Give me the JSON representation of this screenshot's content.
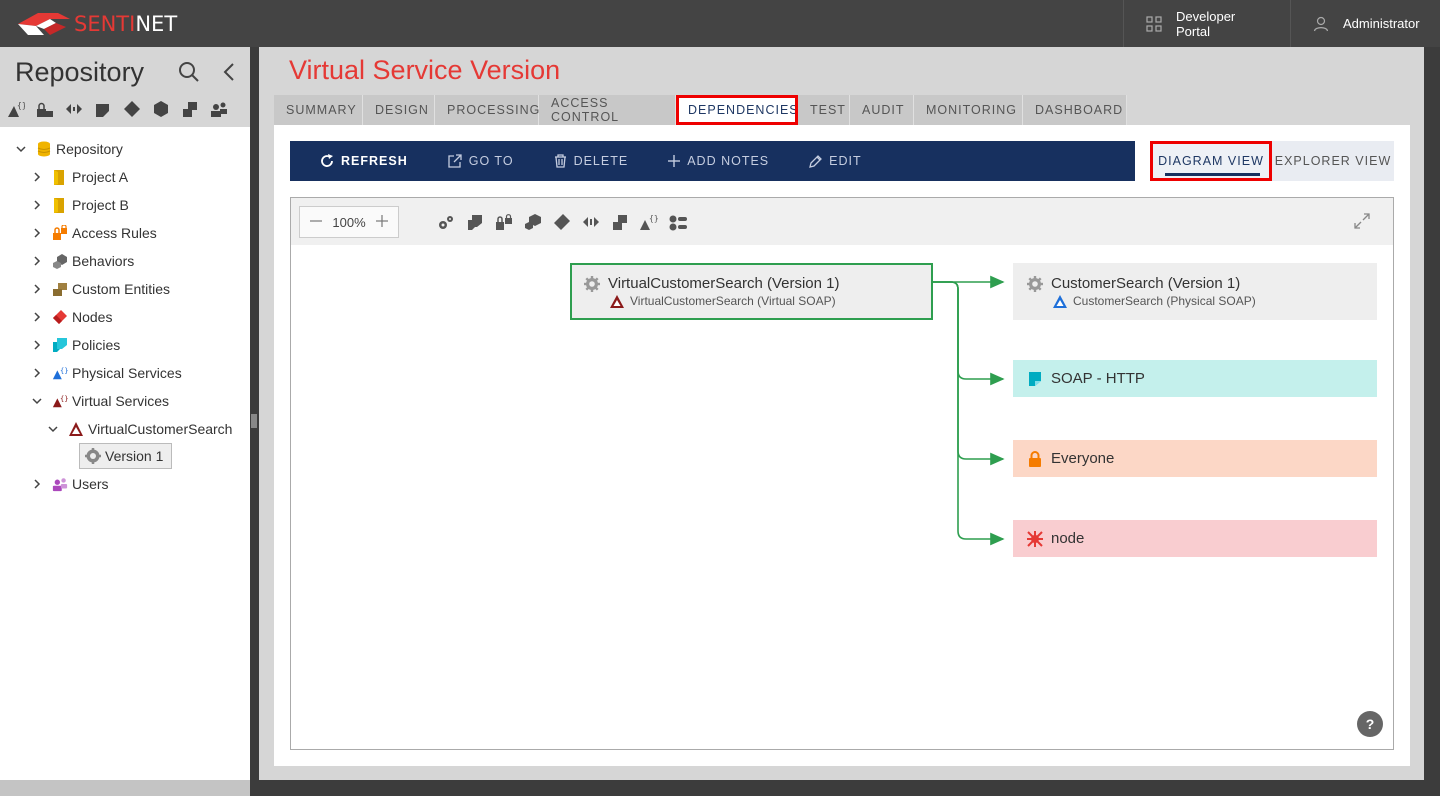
{
  "brand": {
    "name_prefix": "SENTI",
    "name_suffix": "NET"
  },
  "topbar": {
    "developer_portal": "Developer Portal",
    "user": "Administrator"
  },
  "sidebar": {
    "title": "Repository",
    "tree": [
      {
        "label": "Repository",
        "icon": "database-icon"
      },
      {
        "label": "Project A",
        "icon": "project-icon"
      },
      {
        "label": "Project B",
        "icon": "project-icon"
      },
      {
        "label": "Access Rules",
        "icon": "lock-icon"
      },
      {
        "label": "Behaviors",
        "icon": "behavior-icon"
      },
      {
        "label": "Custom Entities",
        "icon": "entity-icon"
      },
      {
        "label": "Nodes",
        "icon": "node-icon"
      },
      {
        "label": "Policies",
        "icon": "policy-icon"
      },
      {
        "label": "Physical Services",
        "icon": "physical-service-icon"
      },
      {
        "label": "Virtual Services",
        "icon": "virtual-service-icon"
      },
      {
        "label": "VirtualCustomerSearch",
        "icon": "virtual-service-icon"
      },
      {
        "label": "Version 1",
        "icon": "gear-icon"
      },
      {
        "label": "Users",
        "icon": "users-icon"
      }
    ]
  },
  "page": {
    "title": "Virtual Service Version",
    "tabs": [
      "SUMMARY",
      "DESIGN",
      "PROCESSING",
      "ACCESS CONTROL",
      "DEPENDENCIES",
      "TEST",
      "AUDIT",
      "MONITORING",
      "DASHBOARD"
    ],
    "active_tab": "DEPENDENCIES"
  },
  "toolbar": {
    "refresh": "REFRESH",
    "goto": "GO TO",
    "delete": "DELETE",
    "add_notes": "ADD NOTES",
    "edit": "EDIT"
  },
  "views": {
    "diagram": "DIAGRAM VIEW",
    "explorer": "EXPLORER VIEW",
    "active": "DIAGRAM VIEW"
  },
  "diagram": {
    "zoom": "100%",
    "help": "?",
    "source": {
      "title": "VirtualCustomerSearch (Version 1)",
      "subtitle": "VirtualCustomerSearch (Virtual SOAP)"
    },
    "targets": [
      {
        "title": "CustomerSearch (Version 1)",
        "subtitle": "CustomerSearch (Physical SOAP)",
        "color": "#eeeeee"
      },
      {
        "title": "SOAP - HTTP",
        "color": "#c4f0ec"
      },
      {
        "title": "Everyone",
        "color": "#fcd7c6"
      },
      {
        "title": "node",
        "color": "#f9cdd0"
      }
    ],
    "link_color": "#2e9e4f"
  },
  "colors": {
    "accent_red": "#e53935",
    "navy": "#17305f",
    "highlight": "#e00000"
  }
}
